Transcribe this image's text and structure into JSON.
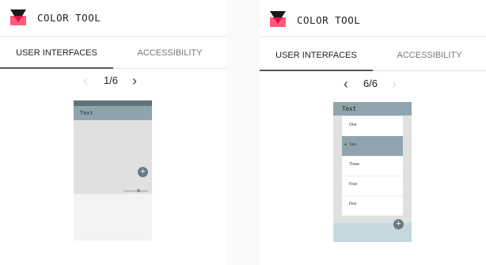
{
  "app": {
    "title": "COLOR TOOL"
  },
  "tabs": [
    "USER INTERFACES",
    "ACCESSIBILITY"
  ],
  "left": {
    "pager": {
      "text": "1/6",
      "prev_icon": "chevron-left-icon",
      "next_icon": "chevron-right-icon"
    },
    "preview": {
      "appbar_title": "Text",
      "fab": "+"
    }
  },
  "right": {
    "pager": {
      "text": "6/6",
      "prev_icon": "chevron-left-icon",
      "next_icon": "chevron-right-icon"
    },
    "preview": {
      "appbar_title": "Text",
      "fab": "+",
      "menu_items": [
        "One",
        "Two",
        "Three",
        "Four",
        "Five"
      ],
      "selected_index": 1
    }
  },
  "colors": {
    "primary": "#90a4ae",
    "primary_dark": "#607478",
    "accent": "#ff1744",
    "bottom_sheet": "#c5d8e0"
  }
}
